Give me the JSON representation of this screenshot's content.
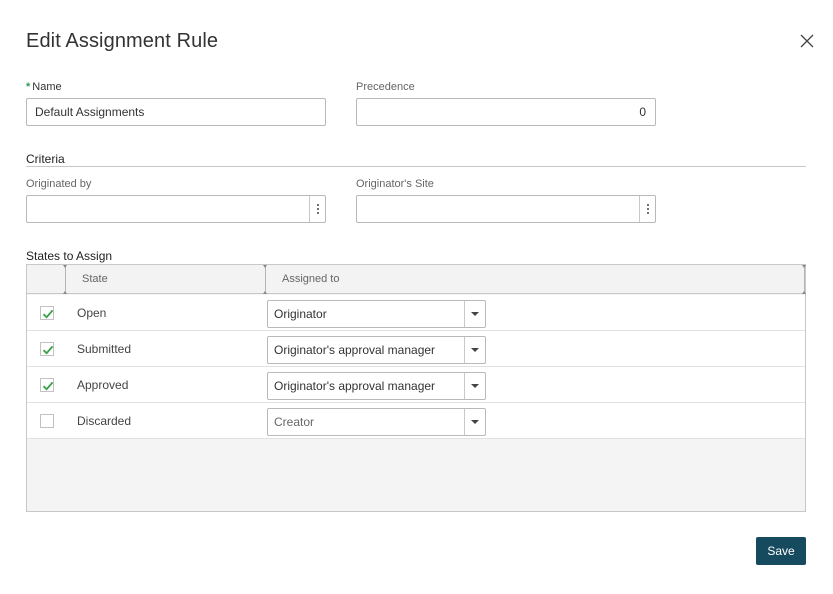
{
  "dialog": {
    "title": "Edit Assignment Rule"
  },
  "form": {
    "name_label": "Name",
    "name_value": "Default Assignments",
    "precedence_label": "Precedence",
    "precedence_value": "0"
  },
  "criteria": {
    "title": "Criteria",
    "originated_by_label": "Originated by",
    "originated_by_value": "",
    "originators_site_label": "Originator's Site",
    "originators_site_value": ""
  },
  "states": {
    "title": "States to Assign",
    "columns": [
      "State",
      "Assigned to"
    ],
    "rows": [
      {
        "checked": true,
        "state": "Open",
        "assigned_to": "Originator"
      },
      {
        "checked": true,
        "state": "Submitted",
        "assigned_to": "Originator's approval manager"
      },
      {
        "checked": true,
        "state": "Approved",
        "assigned_to": "Originator's approval manager"
      },
      {
        "checked": false,
        "state": "Discarded",
        "assigned_to": "Creator"
      }
    ]
  },
  "footer": {
    "save_label": "Save"
  },
  "colors": {
    "primary": "#164a5e",
    "check": "#3aa047",
    "required": "#2e9a5c"
  },
  "icons": {
    "close": "close-icon",
    "lookup": "more-vertical-icon",
    "dropdown": "chevron-down-icon",
    "check": "check-icon"
  }
}
